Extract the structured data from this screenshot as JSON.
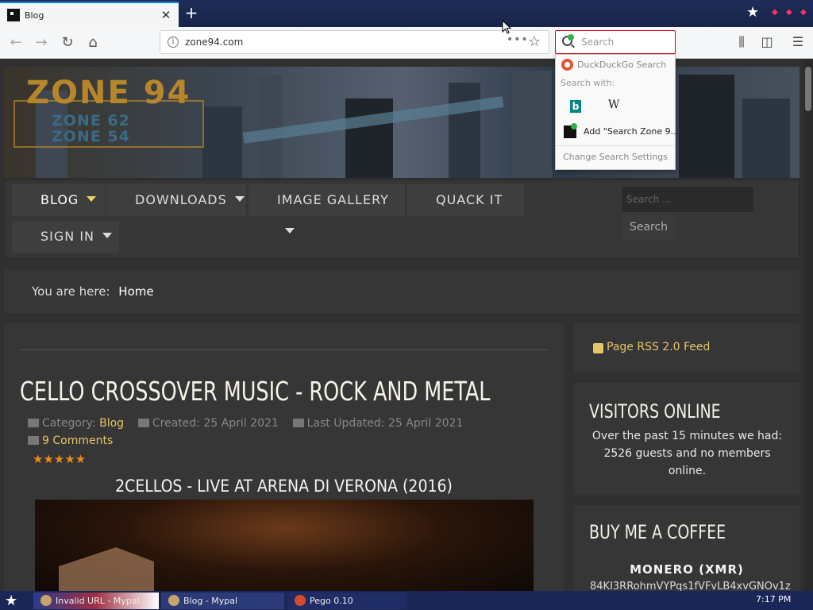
{
  "browser": {
    "tab_title": "Blog",
    "tab_close": "✕",
    "new_tab": "+",
    "url": "zone94.com",
    "url_more": "•••",
    "search_placeholder": "Search"
  },
  "search_dropdown": {
    "default_engine": "DuckDuckGo Search",
    "search_with": "Search with:",
    "bing_glyph": "b",
    "wiki_glyph": "W",
    "add_engine": "Add \"Search Zone 9...",
    "change_settings": "Change Search Settings"
  },
  "banner": {
    "logo_main": "ZONE 94",
    "logo_sub1": "ZONE 62",
    "logo_sub2": "ZONE 54"
  },
  "menu": {
    "items": [
      {
        "label": "BLOG",
        "has_caret": true,
        "active": true
      },
      {
        "label": "DOWNLOADS",
        "has_caret": true
      },
      {
        "label": "IMAGE GALLERY",
        "has_caret": true
      },
      {
        "label": "QUACK IT",
        "has_caret": false
      },
      {
        "label": "SIGN IN",
        "has_caret": true
      }
    ],
    "search_placeholder": "Search ...",
    "search_button": "Search"
  },
  "breadcrumb": {
    "prefix": "You are here:",
    "current": "Home"
  },
  "article": {
    "title": "CELLO CROSSOVER MUSIC - ROCK AND METAL",
    "category_label": "Category:",
    "category_value": "Blog",
    "created": "Created: 25 April 2021",
    "updated": "Last Updated: 25 April 2021",
    "comments": "9 Comments",
    "rating_stars": "★★★★★",
    "video_title": "2CELLOS - LIVE AT ARENA DI VERONA (2016)"
  },
  "sidebar": {
    "rss": "Page RSS 2.0 Feed",
    "visitors_title": "VISITORS ONLINE",
    "visitors_text": "Over the past 15 minutes we had: 2526 guests and no members online.",
    "coffee_title": "BUY ME A COFFEE",
    "monero_label": "MONERO (XMR)",
    "monero_address": "84KI3RRohmVYPqs1fVFvLB4xvGNOv1z"
  },
  "taskbar": {
    "tasks": [
      "Invalid URL - Mypal",
      "Blog - Mypal",
      "Pego 0.10"
    ],
    "clock": "7:17 PM"
  },
  "colors": {
    "accent_gold": "#e5c46a",
    "active_caret": "#f0d060",
    "search_border": "#d0021b",
    "star_orange": "#f08a1b"
  }
}
